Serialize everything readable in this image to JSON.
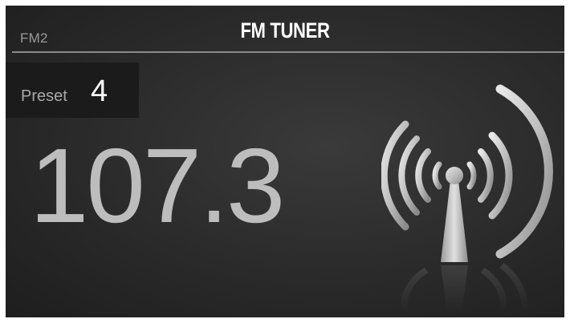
{
  "header": {
    "band": "FM2",
    "title": "FM TUNER"
  },
  "preset": {
    "label": "Preset",
    "number": "4"
  },
  "tuner": {
    "frequency": "107.3"
  },
  "icons": {
    "signal": "radio-antenna-broadcast-icon"
  },
  "colors": {
    "background": "#2a2a2a",
    "text_primary": "#ffffff",
    "text_secondary": "#9a9a9a",
    "frequency": "#bdbdbd"
  }
}
